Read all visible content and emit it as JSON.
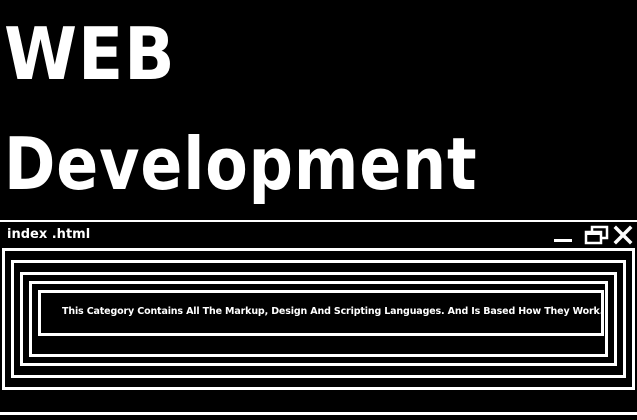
{
  "hero": {
    "line1": "WEB",
    "line2": "Development"
  },
  "window": {
    "title": "index .html",
    "controls": {
      "minimize_icon": "minimize-icon",
      "restore_icon": "restore-icon",
      "close_icon": "close-icon"
    },
    "message": "This Category Contains All The Markup, Design And Scripting Languages. And Is Based How They Work."
  },
  "colors": {
    "background": "#000000",
    "foreground": "#ffffff"
  }
}
